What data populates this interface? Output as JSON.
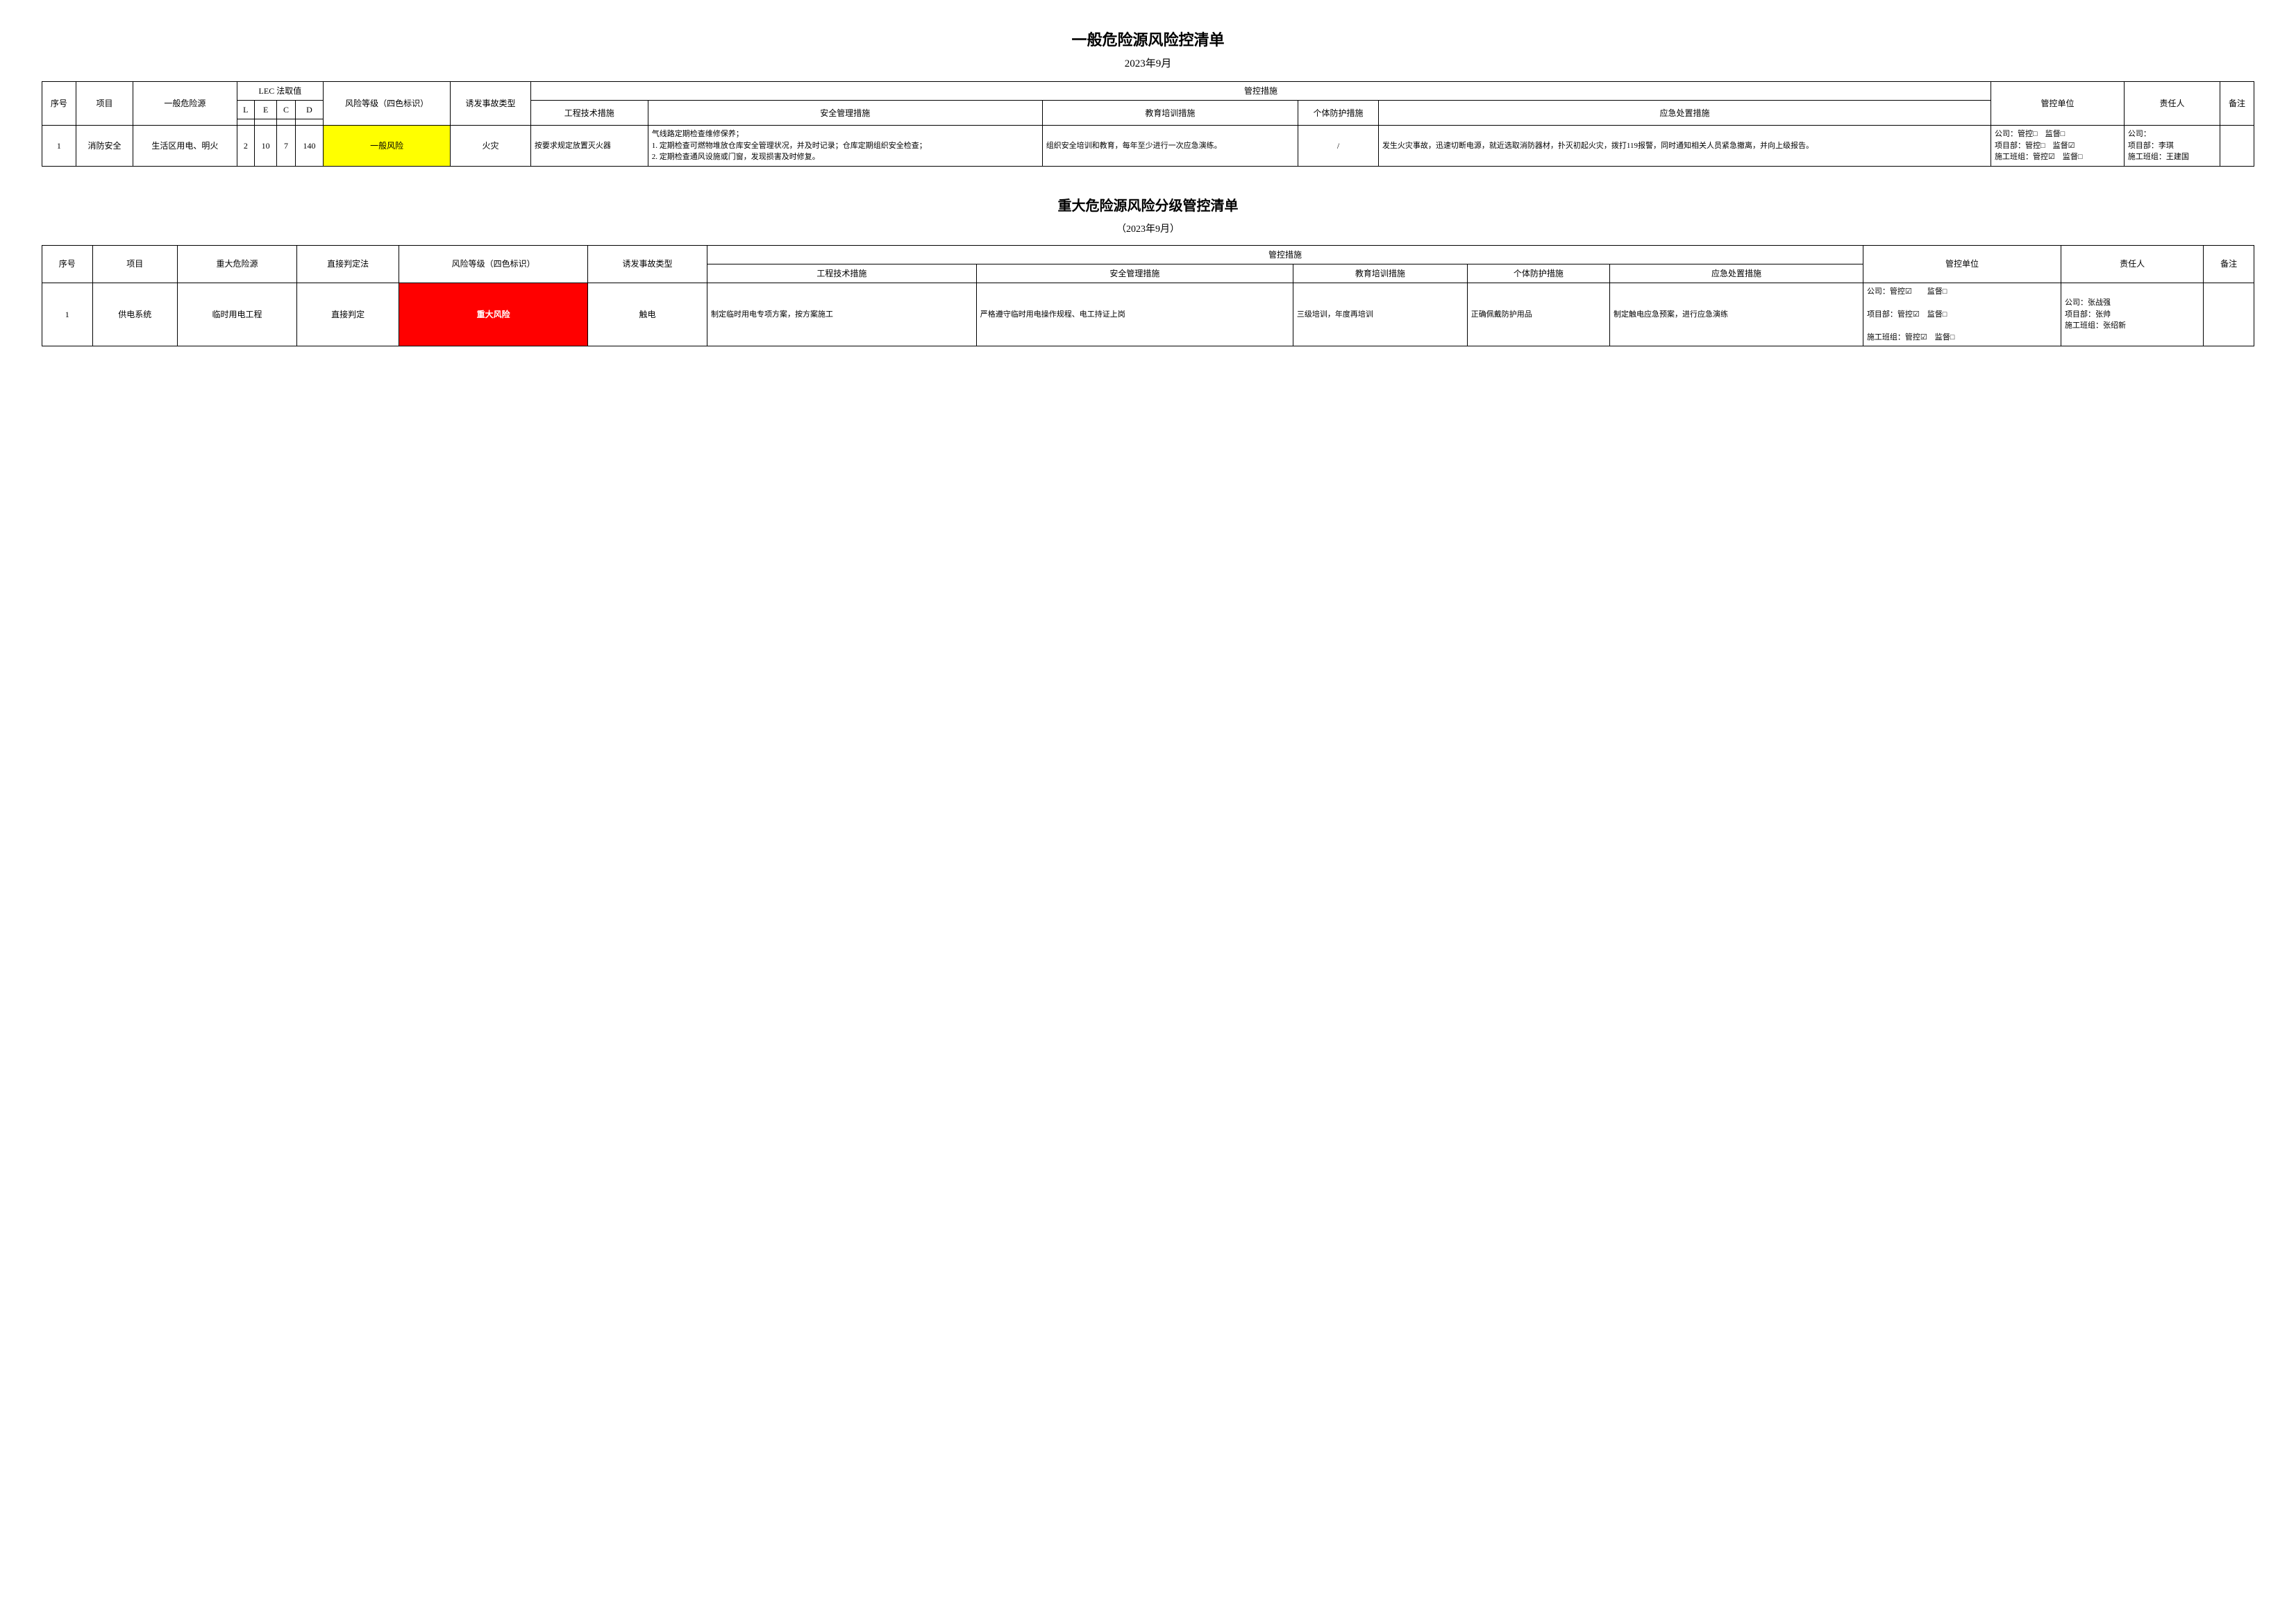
{
  "table1": {
    "title": "一般危险源风险控清单",
    "subtitle": "2023年9月",
    "headers": {
      "col1": "序号",
      "col2": "项目",
      "col3": "一般危险源",
      "lec": "LEC 法取值",
      "lec_l": "L",
      "lec_e": "E",
      "lec_c": "C",
      "lec_d": "D",
      "risk_level": "风险等级（四色标识）",
      "trigger": "诱发事故类型",
      "control_measures": "管控措施",
      "engineering": "工程技术措施",
      "safety_mgmt": "安全管理措施",
      "education": "教育培训措施",
      "individual": "个体防护措施",
      "emergency": "应急处置措施",
      "control_unit": "管控单位",
      "responsible": "责任人",
      "remarks": "备注"
    },
    "rows": [
      {
        "seq": "1",
        "project": "消防安全",
        "hazard": "生活区用电、明火",
        "L": "2",
        "E": "10",
        "C": "7",
        "D": "140",
        "risk_level": "一般风险",
        "risk_class": "yellow",
        "trigger": "火灾",
        "engineering": "按要求规定放置灭火器",
        "safety_mgmt": "气线路定期检查维修保养；",
        "safety_mgmt_detail": "1. 定期检查可燃物堆放仓库安全管理状况，并及时记录；仓库定期组织安全检查；\n2. 定期检查通风设施或门窗，发现损害及时修复。",
        "education": "组织安全培训和教育，每年至少进行一次应急演练。",
        "individual": "/",
        "emergency": "发生火灾事故，迅速切断电源，就近选取消防器材，扑灭初起火灾，拨打119报警，同时通知相关人员紧急撤离，并向上级报告。",
        "control_unit": "公司：管控□　监督□\n项目部：管控□　监督☑\n施工班组：管控☑　监督□",
        "responsible": "公司：\n项目部：李琪\n施工班组：王建国",
        "remarks": ""
      }
    ]
  },
  "table2": {
    "title": "重大危险源风险分级管控清单",
    "subtitle": "（2023年9月）",
    "headers": {
      "col1": "序号",
      "col2": "项目",
      "col3": "重大危险源",
      "col4": "直接判定法",
      "risk_level": "风险等级（四色标识）",
      "trigger": "诱发事故类型",
      "control_measures": "管控措施",
      "engineering": "工程技术措施",
      "safety_mgmt": "安全管理措施",
      "education": "教育培训措施",
      "individual": "个体防护措施",
      "emergency": "应急处置措施",
      "control_unit": "管控单位",
      "responsible": "责任人",
      "remarks": "备注"
    },
    "rows": [
      {
        "seq": "1",
        "project": "供电系统",
        "hazard": "临时用电工程",
        "direct": "直接判定",
        "risk_level": "重大风险",
        "risk_class": "red",
        "trigger": "触电",
        "engineering": "制定临时用电专项方案，按方案施工",
        "safety_mgmt": "严格遵守临时用电操作规程、电工持证上岗",
        "education": "三级培训，年度再培训",
        "individual": "正确佩戴防护用品",
        "emergency": "制定触电应急预案，进行应急演练",
        "control_unit": "公司：管控☑　　监督□\n项目部：管控☑　监督□\n施工班组：管控☑　监督□",
        "responsible": "公司：张战强\n项目部：张帅\n施工班组：张绍新",
        "remarks": ""
      }
    ]
  }
}
